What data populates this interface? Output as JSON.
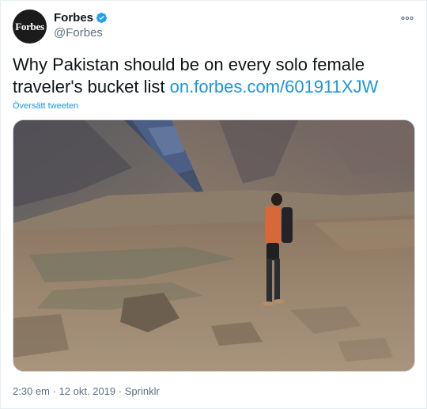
{
  "author": {
    "avatar_text": "Forbes",
    "display_name": "Forbes",
    "handle": "@Forbes"
  },
  "icons": {
    "verified": "verified-badge-icon",
    "more": "more-horizontal-icon"
  },
  "tweet": {
    "text": "Why Pakistan should be on every solo female traveler's bucket list",
    "link": "on.forbes.com/601911XJW",
    "translate_label": "Översätt tweeten"
  },
  "meta": {
    "time": "2:30 em",
    "separator": "·",
    "date": "12 okt. 2019",
    "source": "Sprinklr"
  },
  "colors": {
    "link": "#1b95e0",
    "verified": "#1da1f2",
    "secondary_text": "#5b7083"
  }
}
